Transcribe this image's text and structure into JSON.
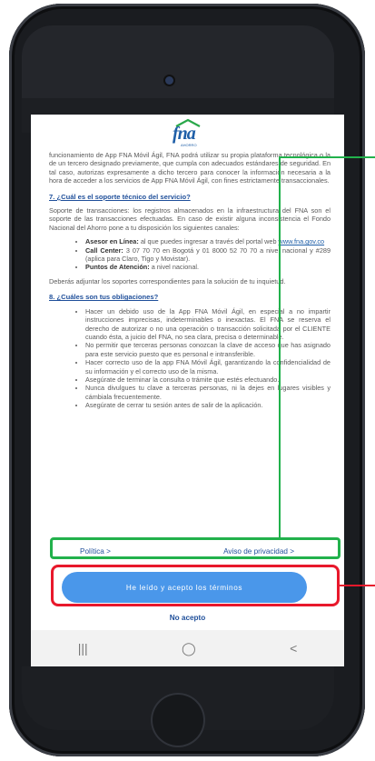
{
  "header": {
    "logo_text": "fna",
    "logo_tag": "AHORRO"
  },
  "content": {
    "para_top": "funcionamiento de App FNA Móvil Ágil, FNA podrá utilizar su propia plataforma tecnológica o la de un tercero designado previamente, que cumpla con adecuados estándares de seguridad. En tal caso, autorizas expresamente a dicho tercero para conocer la información necesaria a la hora de acceder a los servicios de App FNA Móvil Ágil, con fines estrictamente transaccionales.",
    "section7_title": "7. ¿Cuál es el soporte técnico del servicio?",
    "section7_para": "Soporte de transacciones: los registros almacenados en la infraestructura del FNA son el soporte de las transacciones efectuadas. En caso de existir alguna inconsistencia el Fondo Nacional del Ahorro pone a tu disposición los siguientes canales:",
    "channels": [
      {
        "label": "Asesor en Línea:",
        "text": " al que puedes ingresar a través del portal web ",
        "link": "www.fna.gov.co"
      },
      {
        "label": "Call Center:",
        "text": " 3 07 70 70 en Bogotá y 01 8000 52 70 70 a nivel nacional y #289 (aplica para Claro, Tigo y Movistar)."
      },
      {
        "label": "Puntos de Atención:",
        "text": " a nivel nacional."
      }
    ],
    "support_note": "Deberás adjuntar los soportes correspondientes para la solución de tu inquietud.",
    "section8_title": "8. ¿Cuáles son tus obligaciones?",
    "obligations": [
      "Hacer un debido uso de la App FNA Móvil Ágil, en especial a no impartir instrucciones imprecisas, indeterminables o inexactas. El FNA se reserva el derecho de autorizar o no una operación o transacción solicitada por el CLIENTE cuando ésta, a juicio del FNA, no sea clara, precisa o determinable.",
      "No permitir que terceras personas conozcan la clave de acceso que has asignado para este servicio puesto que es personal e intransferible.",
      "Hacer correcto uso de la app FNA Móvil Ágil, garantizando la confidencialidad de su información y el correcto uso de la misma.",
      "Asegúrate de terminar la consulta o trámite que estés efectuando.",
      "Nunca divulgues tu clave a terceras personas, ni la dejes en lugares visibles y cámbiala frecuentemente.",
      "Asegúrate de cerrar tu sesión antes de salir de la aplicación."
    ]
  },
  "links": {
    "policy": "Política >",
    "privacy": "Aviso de privacidad >"
  },
  "actions": {
    "accept": "He leído y acepto los términos",
    "decline": "No acepto"
  },
  "navbar": {
    "recent": "|||",
    "home": "◯",
    "back": "<"
  },
  "colors": {
    "accent": "#4a97ea",
    "link": "#1f4f9a",
    "annotation_green": "#22b14c",
    "annotation_red": "#e8182b"
  }
}
